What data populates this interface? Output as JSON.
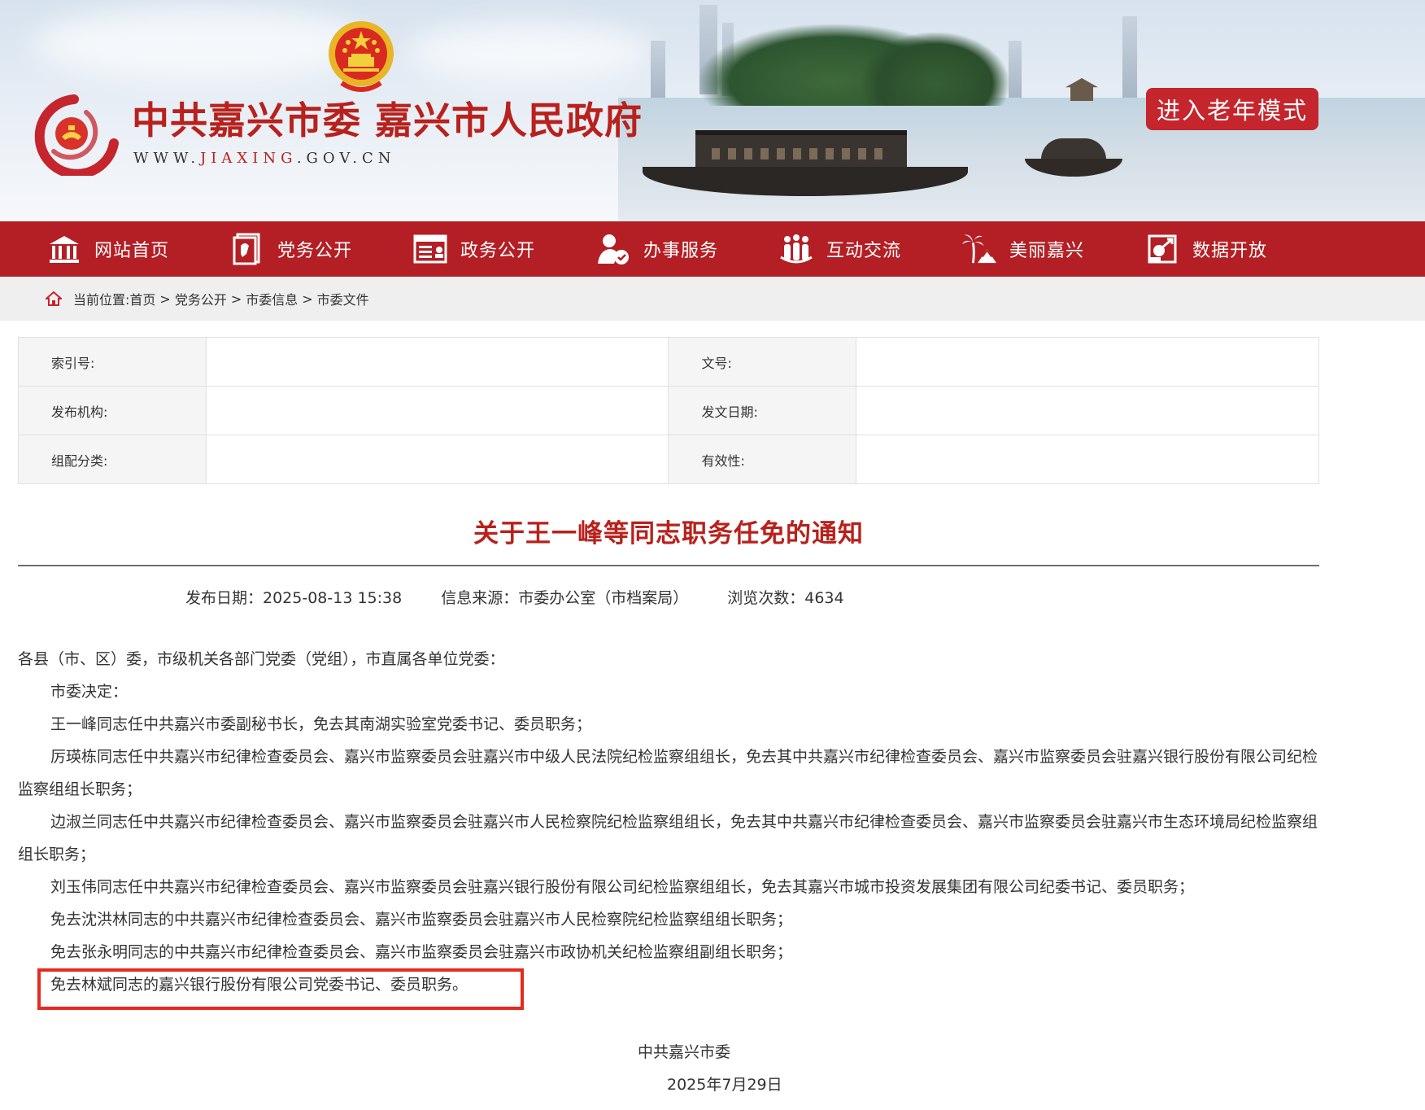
{
  "header": {
    "site_title": "中共嘉兴市委 嘉兴市人民政府",
    "site_url_prefix": "WWW.",
    "site_url_highlight": "JIAXING",
    "site_url_suffix": ".GOV.CN",
    "elder_mode_label": "进入老年模式"
  },
  "nav": {
    "items": [
      {
        "label": "网站首页",
        "icon": "home-icon"
      },
      {
        "label": "党务公开",
        "icon": "party-affairs-icon"
      },
      {
        "label": "政务公开",
        "icon": "gov-affairs-icon"
      },
      {
        "label": "办事服务",
        "icon": "service-icon"
      },
      {
        "label": "互动交流",
        "icon": "interaction-icon"
      },
      {
        "label": "美丽嘉兴",
        "icon": "palm-tree-icon"
      },
      {
        "label": "数据开放",
        "icon": "data-icon"
      }
    ]
  },
  "breadcrumb": {
    "prefix": "当前位置:",
    "items": [
      "首页",
      "党务公开",
      "市委信息",
      "市委文件"
    ],
    "separator": ">"
  },
  "meta": {
    "index_label": "索引号:",
    "doc_no_label": "文号:",
    "issuer_label": "发布机构:",
    "issue_date_label": "发文日期:",
    "category_label": "组配分类:",
    "validity_label": "有效性:"
  },
  "article": {
    "title": "关于王一峰等同志职务任免的通知",
    "publish_date": "发布日期：2025-08-13 15:38",
    "source": "信息来源：市委办公室（市档案局）",
    "views": "浏览次数：4634",
    "salutation": "各县（市、区）委，市级机关各部门党委（党组），市直属各单位党委：",
    "paragraphs": [
      "市委决定：",
      "王一峰同志任中共嘉兴市委副秘书长，免去其南湖实验室党委书记、委员职务；",
      "厉瑛栋同志任中共嘉兴市纪律检查委员会、嘉兴市监察委员会驻嘉兴市中级人民法院纪检监察组组长，免去其中共嘉兴市纪律检查委员会、嘉兴市监察委员会驻嘉兴银行股份有限公司纪检监察组组长职务；",
      "边淑兰同志任中共嘉兴市纪律检查委员会、嘉兴市监察委员会驻嘉兴市人民检察院纪检监察组组长，免去其中共嘉兴市纪律检查委员会、嘉兴市监察委员会驻嘉兴市生态环境局纪检监察组组长职务；",
      "刘玉伟同志任中共嘉兴市纪律检查委员会、嘉兴市监察委员会驻嘉兴银行股份有限公司纪检监察组组长，免去其嘉兴市城市投资发展集团有限公司纪委书记、委员职务；",
      "免去沈洪林同志的中共嘉兴市纪律检查委员会、嘉兴市监察委员会驻嘉兴市人民检察院纪检监察组组长职务；",
      "免去张永明同志的中共嘉兴市纪律检查委员会、嘉兴市监察委员会驻嘉兴市政协机关纪检监察组副组长职务；",
      "免去林斌同志的嘉兴银行股份有限公司党委书记、委员职务。"
    ],
    "signature_org": "中共嘉兴市委",
    "signature_date": "2025年7月29日"
  },
  "colors": {
    "brand_red": "#b31f24",
    "title_red": "#b8211c",
    "highlight_box": "#e42b1f"
  }
}
